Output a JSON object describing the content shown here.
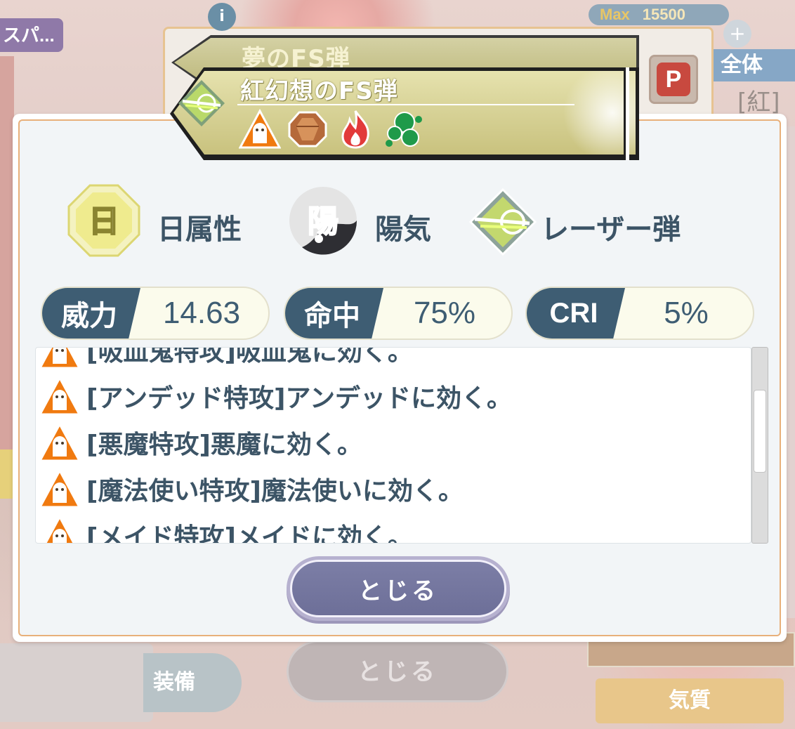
{
  "background": {
    "tag_label": "スパ...",
    "info_label": "i",
    "max_label": "Max",
    "max_value": "15500",
    "plus_label": "+",
    "p_label": "P",
    "zentai_label": "全体",
    "kurenai_label": "[紅]",
    "close_ghost_label": "とじる",
    "soubi_label": "装備",
    "kishitsu_label": "気質"
  },
  "bullets": {
    "back_title": "夢のFS弾",
    "front_title": "紅幻想のFS弾",
    "trait_icons": [
      "ghost-warning-icon",
      "gem-icon",
      "fire-icon",
      "poison-icon"
    ]
  },
  "attributes": [
    {
      "icon": "sun-attribute-icon",
      "glyph": "日",
      "label": "日属性"
    },
    {
      "icon": "yang-energy-icon",
      "glyph": "陽",
      "label": "陽気"
    },
    {
      "icon": "laser-bullet-icon",
      "glyph": "",
      "label": "レーザー弾"
    }
  ],
  "stats": [
    {
      "key": "威力",
      "value": "14.63"
    },
    {
      "key": "命中",
      "value": "75%"
    },
    {
      "key": "CRI",
      "value": "5%"
    }
  ],
  "effects": [
    "[吸血鬼特攻]吸血鬼に効く。",
    "[アンデッド特攻]アンデッドに効く。",
    "[悪魔特攻]悪魔に効く。",
    "[魔法使い特攻]魔法使いに効く。",
    "[メイド特攻]メイドに効く。"
  ],
  "close_button": {
    "label": "とじる"
  },
  "colors": {
    "accent_navy": "#3e5d73",
    "modal_border": "#e8b07a",
    "button_purple": "#6d6f98",
    "warning_orange": "#f07a10"
  }
}
